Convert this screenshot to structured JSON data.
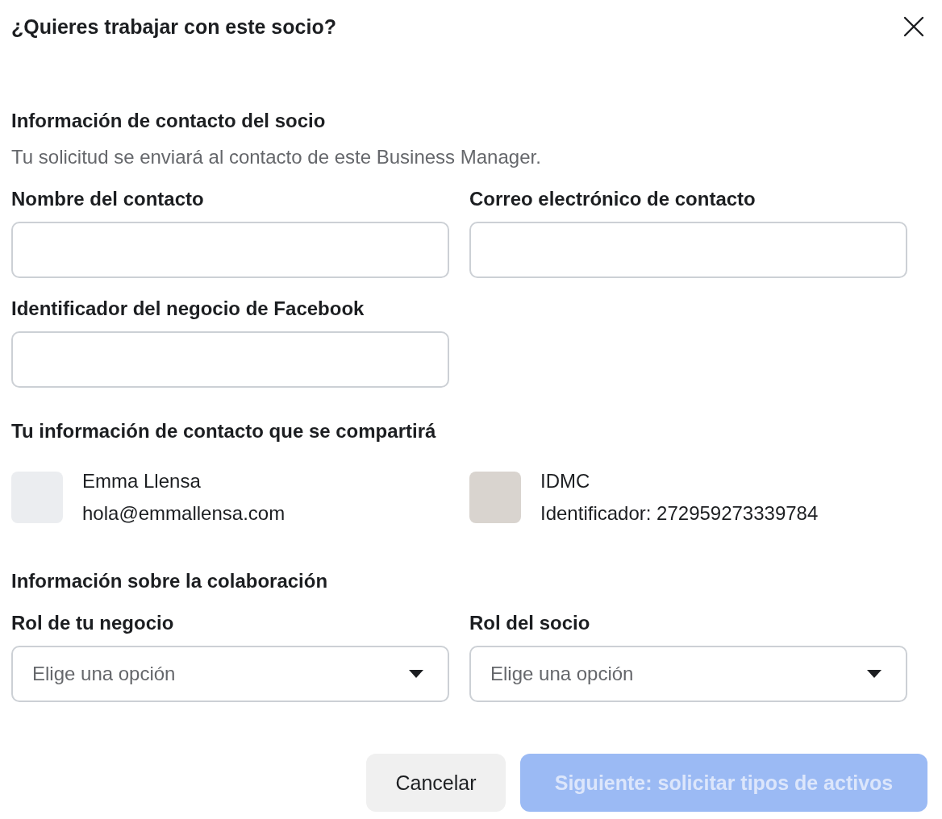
{
  "dialog": {
    "title": "¿Quieres trabajar con este socio?"
  },
  "partner_info": {
    "heading": "Información de contacto del socio",
    "description": "Tu solicitud se enviará al contacto de este Business Manager.",
    "fields": [
      {
        "label": "Nombre del contacto"
      },
      {
        "label": "Correo electrónico de contacto"
      },
      {
        "label": "Identificador del negocio de Facebook"
      }
    ]
  },
  "your_info": {
    "heading": "Tu información de contacto que se compartirá",
    "contacts": [
      {
        "kind": "blank",
        "name": "Emma Llensa",
        "detail": "hola@emmallensa.com"
      },
      {
        "kind": "photo",
        "name": "IDMC",
        "detail": "Identificador: 272959273339784"
      }
    ]
  },
  "collaboration": {
    "heading": "Información sobre la colaboración",
    "selects": [
      {
        "label": "Rol de tu negocio",
        "placeholder": "Elige una opción"
      },
      {
        "label": "Rol del socio",
        "placeholder": "Elige una opción"
      }
    ]
  },
  "buttons": [
    {
      "label": "Cancelar",
      "kind": "secondary",
      "disabled": false
    },
    {
      "label": "Siguiente: solicitar tipos de activos",
      "kind": "primary",
      "disabled": true
    }
  ]
}
